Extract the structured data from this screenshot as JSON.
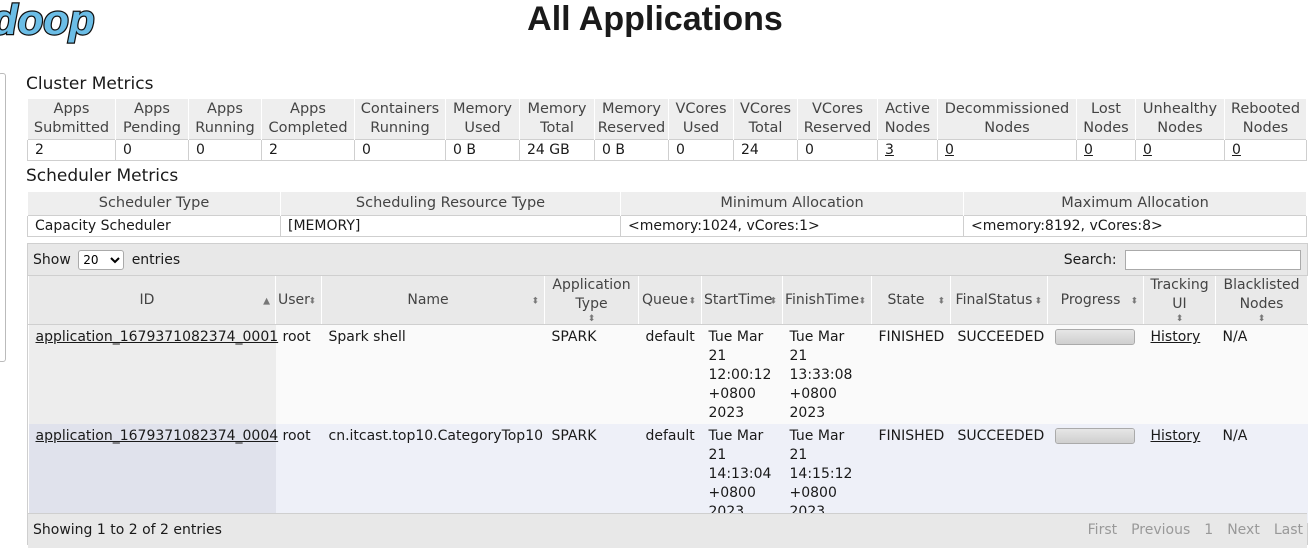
{
  "logo": {
    "text": "doop"
  },
  "page_title": "All Applications",
  "cluster_metrics": {
    "title": "Cluster Metrics",
    "headers": [
      [
        "Apps",
        "Submitted"
      ],
      [
        "Apps",
        "Pending"
      ],
      [
        "Apps",
        "Running"
      ],
      [
        "Apps",
        "Completed"
      ],
      [
        "Containers",
        "Running"
      ],
      [
        "Memory",
        "Used"
      ],
      [
        "Memory",
        "Total"
      ],
      [
        "Memory",
        "Reserved"
      ],
      [
        "VCores",
        "Used"
      ],
      [
        "VCores",
        "Total"
      ],
      [
        "VCores",
        "Reserved"
      ],
      [
        "Active",
        "Nodes"
      ],
      [
        "Decommissioned",
        "Nodes"
      ],
      [
        "Lost",
        "Nodes"
      ],
      [
        "Unhealthy",
        "Nodes"
      ],
      [
        "Rebooted",
        "Nodes"
      ]
    ],
    "values": [
      "2",
      "0",
      "0",
      "2",
      "0",
      "0 B",
      "24 GB",
      "0 B",
      "0",
      "24",
      "0",
      "3",
      "0",
      "0",
      "0",
      "0"
    ]
  },
  "scheduler_metrics": {
    "title": "Scheduler Metrics",
    "headers": [
      "Scheduler Type",
      "Scheduling Resource Type",
      "Minimum Allocation",
      "Maximum Allocation"
    ],
    "values": [
      "Capacity Scheduler",
      "[MEMORY]",
      "<memory:1024, vCores:1>",
      "<memory:8192, vCores:8>"
    ]
  },
  "apps_table": {
    "show_label": "Show",
    "entries_label": "entries",
    "page_size": "20",
    "search_label": "Search:",
    "search_value": "",
    "columns": [
      [
        "ID"
      ],
      [
        "User"
      ],
      [
        "Name"
      ],
      [
        "Application",
        "Type"
      ],
      [
        "Queue"
      ],
      [
        "StartTime"
      ],
      [
        "FinishTime"
      ],
      [
        "State"
      ],
      [
        "FinalStatus"
      ],
      [
        "Progress"
      ],
      [
        "Tracking",
        "UI"
      ],
      [
        "Blacklisted",
        "Nodes"
      ]
    ],
    "rows": [
      {
        "id": "application_1679371082374_0001",
        "user": "root",
        "name": "Spark shell",
        "type": "SPARK",
        "queue": "default",
        "start": [
          "Tue Mar",
          "21",
          "12:00:12",
          "+0800",
          "2023"
        ],
        "finish": [
          "Tue Mar",
          "21",
          "13:33:08",
          "+0800",
          "2023"
        ],
        "state": "FINISHED",
        "final_status": "SUCCEEDED",
        "progress_fraction": 1.0,
        "tracking": "History",
        "blacklisted": "N/A"
      },
      {
        "id": "application_1679371082374_0004",
        "user": "root",
        "name": "cn.itcast.top10.CategoryTop10",
        "type": "SPARK",
        "queue": "default",
        "start": [
          "Tue Mar",
          "21",
          "14:13:04",
          "+0800",
          "2023"
        ],
        "finish": [
          "Tue Mar",
          "21",
          "14:15:12",
          "+0800",
          "2023"
        ],
        "state": "FINISHED",
        "final_status": "SUCCEEDED",
        "progress_fraction": 1.0,
        "tracking": "History",
        "blacklisted": "N/A"
      }
    ],
    "footer_info": "Showing 1 to 2 of 2 entries",
    "pager": [
      "First",
      "Previous",
      "1",
      "Next",
      "Last"
    ]
  }
}
